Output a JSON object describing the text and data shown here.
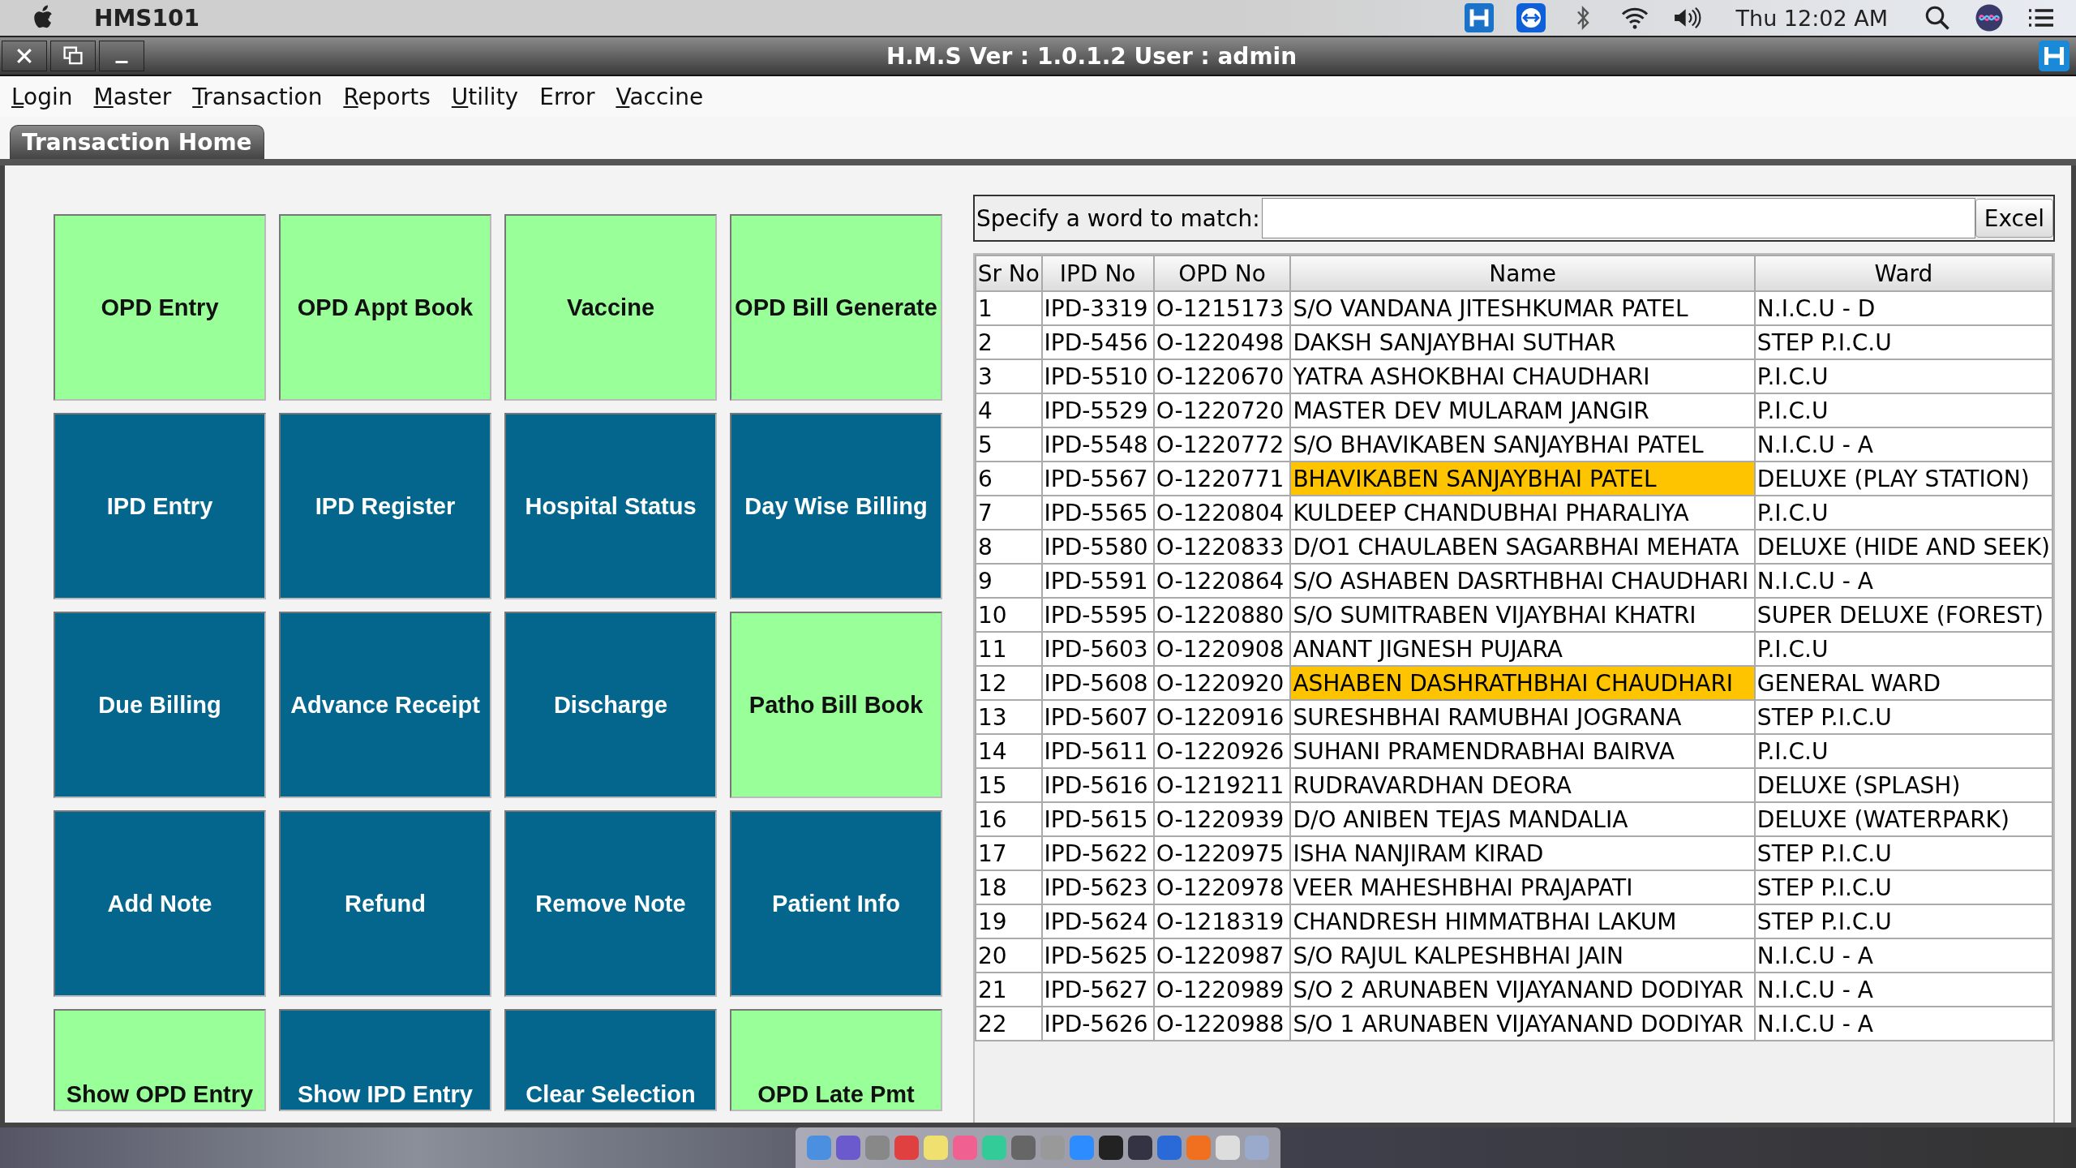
{
  "os_menubar": {
    "app_name": "HMS101",
    "clock": "Thu 12:02 AM"
  },
  "window": {
    "title": "H.M.S Ver : 1.0.1.2 User : admin"
  },
  "menu": [
    {
      "label": "Login",
      "mnemonic": true
    },
    {
      "label": "Master",
      "mnemonic": true
    },
    {
      "label": "Transaction",
      "mnemonic": true
    },
    {
      "label": "Reports",
      "mnemonic": true
    },
    {
      "label": "Utility",
      "mnemonic": true
    },
    {
      "label": "Error",
      "mnemonic": false
    },
    {
      "label": "Vaccine",
      "mnemonic": true
    }
  ],
  "tabs": [
    {
      "label": "Transaction Home",
      "selected": true
    }
  ],
  "buttons": [
    {
      "label": "OPD Entry",
      "kind": "green"
    },
    {
      "label": "OPD Appt Book",
      "kind": "green"
    },
    {
      "label": "Vaccine",
      "kind": "green"
    },
    {
      "label": "OPD Bill Generate",
      "kind": "green"
    },
    {
      "label": "IPD Entry",
      "kind": "blue"
    },
    {
      "label": "IPD Register",
      "kind": "blue"
    },
    {
      "label": "Hospital Status",
      "kind": "blue"
    },
    {
      "label": "Day Wise Billing",
      "kind": "blue"
    },
    {
      "label": "Due Billing",
      "kind": "blue"
    },
    {
      "label": "Advance Receipt",
      "kind": "blue"
    },
    {
      "label": "Discharge",
      "kind": "blue"
    },
    {
      "label": "Patho Bill Book",
      "kind": "green"
    },
    {
      "label": "Add Note",
      "kind": "blue"
    },
    {
      "label": "Refund",
      "kind": "blue"
    },
    {
      "label": "Remove Note",
      "kind": "blue"
    },
    {
      "label": "Patient Info",
      "kind": "blue"
    },
    {
      "label": "Show OPD Entry",
      "kind": "green"
    },
    {
      "label": "Show IPD Entry",
      "kind": "blue"
    },
    {
      "label": "Clear Selection",
      "kind": "blue"
    },
    {
      "label": "OPD Late Pmt",
      "kind": "green"
    }
  ],
  "search": {
    "label": "Specify a word to match:",
    "excel_button": "Excel"
  },
  "table": {
    "columns": [
      "Sr No",
      "IPD No",
      "OPD No",
      "Name",
      "Ward"
    ],
    "rows": [
      {
        "cells": [
          "1",
          "IPD-3319",
          "O-1215173",
          "S/O VANDANA JITESHKUMAR PATEL",
          "N.I.C.U - D"
        ],
        "highlighted": false
      },
      {
        "cells": [
          "2",
          "IPD-5456",
          "O-1220498",
          "DAKSH  SANJAYBHAI SUTHAR",
          "STEP P.I.C.U"
        ],
        "highlighted": false
      },
      {
        "cells": [
          "3",
          "IPD-5510",
          "O-1220670",
          "YATRA ASHOKBHAI CHAUDHARI",
          "P.I.C.U"
        ],
        "highlighted": false
      },
      {
        "cells": [
          "4",
          "IPD-5529",
          "O-1220720",
          "MASTER DEV MULARAM JANGIR",
          "P.I.C.U"
        ],
        "highlighted": false
      },
      {
        "cells": [
          "5",
          "IPD-5548",
          "O-1220772",
          "S/O BHAVIKABEN SANJAYBHAI PATEL",
          "N.I.C.U - A"
        ],
        "highlighted": false
      },
      {
        "cells": [
          "6",
          "IPD-5567",
          "O-1220771",
          "BHAVIKABEN SANJAYBHAI PATEL",
          "DELUXE (PLAY STATION)"
        ],
        "highlighted": true
      },
      {
        "cells": [
          "7",
          "IPD-5565",
          "O-1220804",
          "KULDEEP CHANDUBHAI PHARALIYA",
          "P.I.C.U"
        ],
        "highlighted": false
      },
      {
        "cells": [
          "8",
          "IPD-5580",
          "O-1220833",
          "D/O1 CHAULABEN SAGARBHAI MEHATA",
          "DELUXE (HIDE AND SEEK)"
        ],
        "highlighted": false
      },
      {
        "cells": [
          "9",
          "IPD-5591",
          "O-1220864",
          "S/O ASHABEN  DASRTHBHAI CHAUDHARI",
          "N.I.C.U - A"
        ],
        "highlighted": false
      },
      {
        "cells": [
          "10",
          "IPD-5595",
          "O-1220880",
          "S/O SUMITRABEN VIJAYBHAI KHATRI",
          "SUPER DELUXE (FOREST)"
        ],
        "highlighted": false
      },
      {
        "cells": [
          "11",
          "IPD-5603",
          "O-1220908",
          "ANANT JIGNESH PUJARA",
          "P.I.C.U"
        ],
        "highlighted": false
      },
      {
        "cells": [
          "12",
          "IPD-5608",
          "O-1220920",
          "ASHABEN DASHRATHBHAI CHAUDHARI",
          "GENERAL WARD"
        ],
        "highlighted": true
      },
      {
        "cells": [
          "13",
          "IPD-5607",
          "O-1220916",
          "SURESHBHAI RAMUBHAI JOGRANA",
          "STEP P.I.C.U"
        ],
        "highlighted": false
      },
      {
        "cells": [
          "14",
          "IPD-5611",
          "O-1220926",
          "SUHANI PRAMENDRABHAI BAIRVA",
          "P.I.C.U"
        ],
        "highlighted": false
      },
      {
        "cells": [
          "15",
          "IPD-5616",
          "O-1219211",
          "RUDRAVARDHAN DEORA",
          "DELUXE (SPLASH)"
        ],
        "highlighted": false
      },
      {
        "cells": [
          "16",
          "IPD-5615",
          "O-1220939",
          "D/O ANIBEN TEJAS MANDALIA",
          "DELUXE (WATERPARK)"
        ],
        "highlighted": false
      },
      {
        "cells": [
          "17",
          "IPD-5622",
          "O-1220975",
          "ISHA NANJIRAM KIRAD",
          "STEP P.I.C.U"
        ],
        "highlighted": false
      },
      {
        "cells": [
          "18",
          "IPD-5623",
          "O-1220978",
          "VEER  MAHESHBHAI PRAJAPATI",
          "STEP P.I.C.U"
        ],
        "highlighted": false
      },
      {
        "cells": [
          "19",
          "IPD-5624",
          "O-1218319",
          "CHANDRESH HIMMATBHAI LAKUM",
          "STEP P.I.C.U"
        ],
        "highlighted": false
      },
      {
        "cells": [
          "20",
          "IPD-5625",
          "O-1220987",
          "S/O RAJUL KALPESHBHAI JAIN",
          "N.I.C.U - A"
        ],
        "highlighted": false
      },
      {
        "cells": [
          "21",
          "IPD-5627",
          "O-1220989",
          "S/O 2 ARUNABEN  VIJAYANAND  DODIYAR",
          "N.I.C.U - A"
        ],
        "highlighted": false
      },
      {
        "cells": [
          "22",
          "IPD-5626",
          "O-1220988",
          "S/O 1 ARUNABEN VIJAYANAND DODIYAR",
          "N.I.C.U - A"
        ],
        "highlighted": false
      }
    ]
  }
}
